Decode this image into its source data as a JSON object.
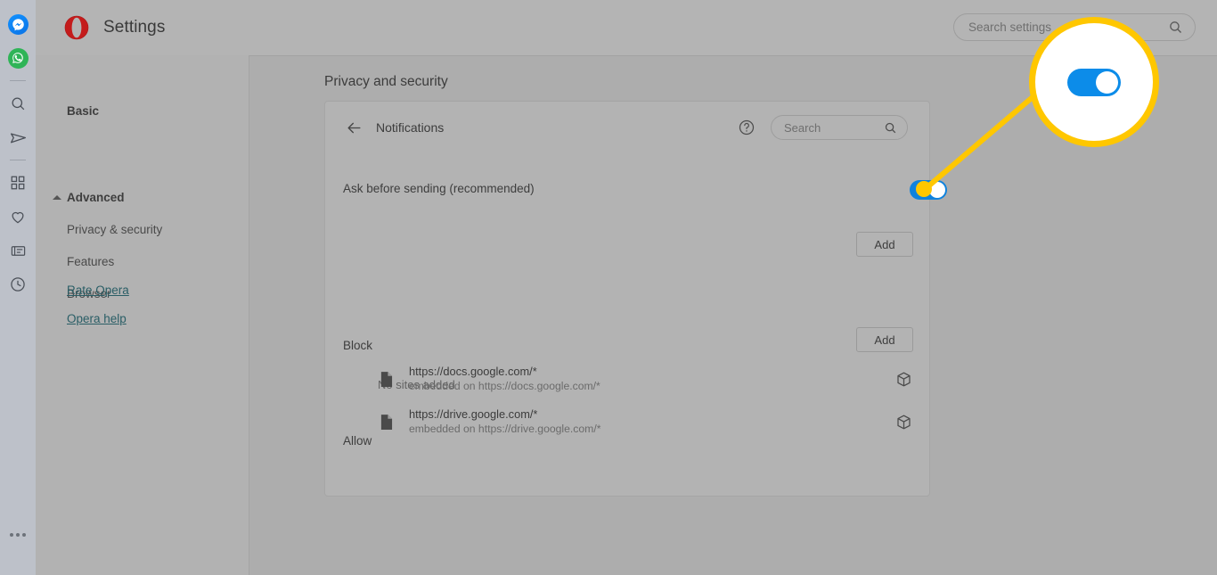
{
  "colors": {
    "accent_toggle_on": "#0f82dd",
    "callout_yellow": "#ffc700",
    "opera_red": "#cc1a1a",
    "page_background": "#adadad",
    "card_background": "#b3b3b3",
    "link": "#2a5e66"
  },
  "icon_rail": {
    "items": [
      {
        "name": "messenger-icon",
        "label": "Messenger"
      },
      {
        "name": "whatsapp-icon",
        "label": "WhatsApp"
      },
      {
        "name": "rail-divider-1",
        "label": ""
      },
      {
        "name": "search-icon",
        "label": "Search"
      },
      {
        "name": "send-icon",
        "label": "Telegram"
      },
      {
        "name": "rail-divider-2",
        "label": ""
      },
      {
        "name": "apps-grid-icon",
        "label": "Speed Dial"
      },
      {
        "name": "heart-icon",
        "label": "Favorites"
      },
      {
        "name": "news-icon",
        "label": "News"
      },
      {
        "name": "history-clock-icon",
        "label": "History"
      }
    ],
    "more_label": "…"
  },
  "header": {
    "title": "Settings",
    "logo_name": "opera-logo",
    "search": {
      "placeholder": "Search settings",
      "value": "",
      "icon": "search-icon"
    }
  },
  "sidebar": {
    "items": [
      {
        "label": "Basic",
        "bold": true
      },
      {
        "label": "Advanced",
        "bold": true,
        "expanded": true,
        "caret": "chevron-up-icon"
      },
      {
        "label": "Privacy & security",
        "bold": false
      },
      {
        "label": "Features",
        "bold": false
      },
      {
        "label": "Browser",
        "bold": false
      }
    ],
    "links": [
      {
        "label": "Rate Opera"
      },
      {
        "label": "Opera help"
      }
    ]
  },
  "main": {
    "heading": "Privacy and security",
    "card": {
      "back_icon": "back-arrow-icon",
      "title": "Notifications",
      "help_icon": "help-circle-icon",
      "search": {
        "placeholder": "Search",
        "value": "",
        "icon": "search-icon"
      },
      "ask_row": {
        "label": "Ask before sending (recommended)",
        "toggle_state": "on"
      },
      "block_section": {
        "label": "Block",
        "add_label": "Add",
        "empty_text": "No sites added",
        "sites": []
      },
      "allow_section": {
        "label": "Allow",
        "add_label": "Add",
        "sites": [
          {
            "url": "https://docs.google.com/*",
            "embedded": "embedded on https://docs.google.com/*",
            "doc_icon": "document-icon",
            "action_icon": "cube-icon"
          },
          {
            "url": "https://drive.google.com/*",
            "embedded": "embedded on https://drive.google.com/*",
            "doc_icon": "document-icon",
            "action_icon": "cube-icon"
          }
        ]
      }
    }
  },
  "callout": {
    "magnified_element": "ask-before-sending-toggle",
    "toggle_state": "on"
  }
}
